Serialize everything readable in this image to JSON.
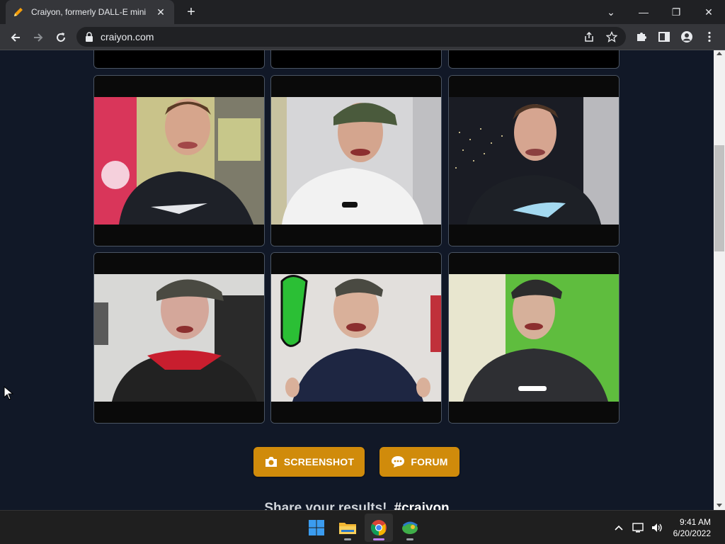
{
  "browser": {
    "tab_title": "Craiyon, formerly DALL-E mini",
    "url": "craiyon.com",
    "icons": {
      "favicon": "pencil-icon",
      "close_tab": "close-icon",
      "new_tab": "plus-icon",
      "back": "back-arrow-icon",
      "forward": "forward-arrow-icon",
      "reload": "reload-icon",
      "lock": "lock-icon",
      "share": "share-icon",
      "bookmark": "star-icon",
      "extensions": "puzzle-icon",
      "side_panel": "side-panel-icon",
      "profile": "profile-icon",
      "menu": "kebab-menu-icon"
    }
  },
  "content": {
    "tiles_count_visible": 6,
    "buttons": {
      "screenshot_label": "SCREENSHOT",
      "forum_label": "FORUM"
    },
    "share_text": "Share your results!",
    "share_hashtag": "#craiyon",
    "accent_color": "#d08b0b"
  },
  "taskbar": {
    "apps": [
      "windows-start-icon",
      "file-explorer-icon",
      "chrome-icon",
      "app-icon"
    ],
    "time": "9:41 AM",
    "date": "6/20/2022"
  }
}
